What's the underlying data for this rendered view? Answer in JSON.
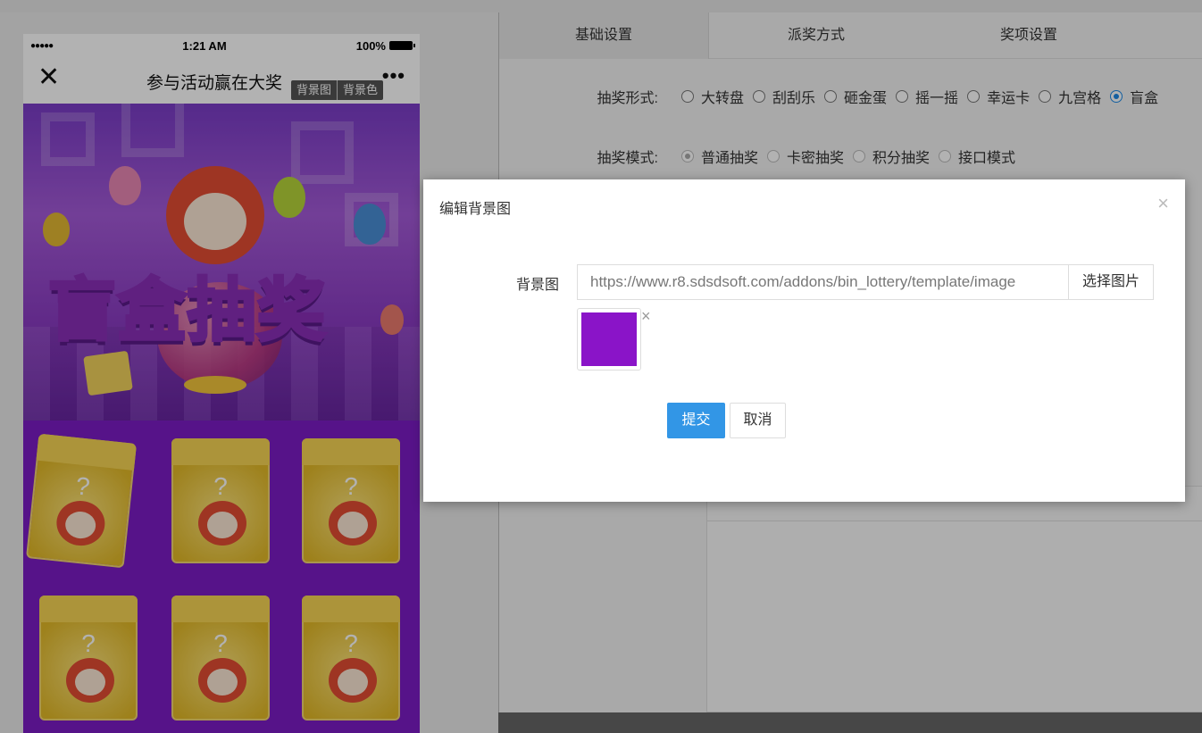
{
  "phone": {
    "status": {
      "signal": "●●●●●",
      "time": "1:21 AM",
      "battery": "100%"
    },
    "nav": {
      "close_icon": "close-icon",
      "title": "参与活动赢在大奖",
      "more_icon": "more-icon"
    },
    "bg_tags": {
      "image": "背景图",
      "color": "背景色"
    },
    "banner_title": "盲盒抽奖",
    "box_glyph": "?"
  },
  "settings": {
    "tabs": [
      {
        "label": "基础设置",
        "active": true
      },
      {
        "label": "派奖方式",
        "active": false
      },
      {
        "label": "奖项设置",
        "active": false
      }
    ],
    "lottery_form": {
      "label": "抽奖形式:",
      "options": [
        "大转盘",
        "刮刮乐",
        "砸金蛋",
        "摇一摇",
        "幸运卡",
        "九宫格",
        "盲盒"
      ],
      "selected": "盲盒"
    },
    "lottery_mode": {
      "label": "抽奖模式:",
      "options": [
        "普通抽奖",
        "卡密抽奖",
        "积分抽奖",
        "接口模式"
      ],
      "selected": "普通抽奖"
    }
  },
  "modal": {
    "title": "编辑背景图",
    "close_icon": "close-icon",
    "field_label": "背景图",
    "url_value": "https://www.r8.sdsdsoft.com/addons/bin_lottery/template/image",
    "pick_label": "选择图片",
    "preview_color": "#8a14c8",
    "remove_icon": "×",
    "submit_label": "提交",
    "cancel_label": "取消"
  },
  "colors": {
    "accent": "#3296e6",
    "overlay": "rgba(0,0,0,0.3)"
  }
}
